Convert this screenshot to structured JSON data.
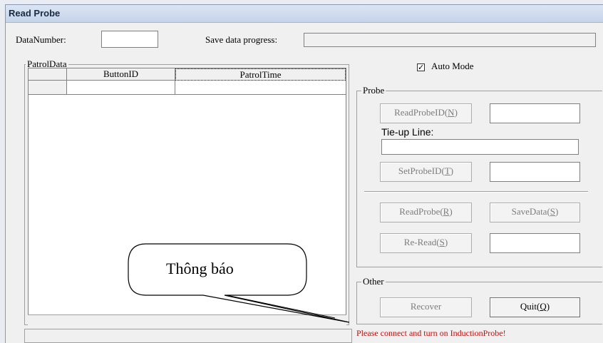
{
  "window": {
    "title": "Read Probe"
  },
  "top": {
    "data_number_label": "DataNumber:",
    "save_progress_label": "Save data progress:",
    "data_number_value": "",
    "save_progress_fraction": 0
  },
  "patrol": {
    "legend": "PatrolData",
    "columns": [
      "ButtonID",
      "PatrolTime"
    ]
  },
  "auto_mode": {
    "label": "Auto Mode",
    "checked": true,
    "mark": "✓"
  },
  "probe": {
    "legend": "Probe",
    "read_probe_id": "ReadProbeID(N)",
    "tie_up_label": "Tie-up Line:",
    "set_probe_id": "SetProbeID(T)",
    "read_probe": "ReadProbe(R)",
    "save_data": "SaveData(S)",
    "re_read": "Re-Read(S)"
  },
  "other": {
    "legend": "Other",
    "recover": "Recover",
    "quit": "Quit(Q)"
  },
  "status": {
    "message": "Please connect and turn on InductionProbe!",
    "color": "#e00000"
  },
  "callout": {
    "text": "Thông báo"
  }
}
